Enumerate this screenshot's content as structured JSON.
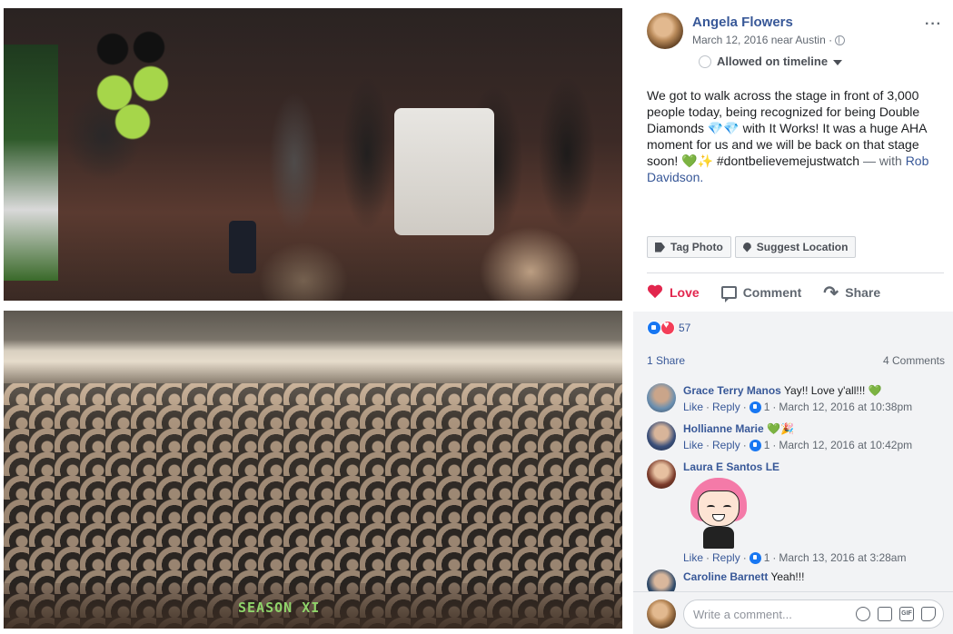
{
  "post": {
    "author": "Angela Flowers",
    "meta": "March 12, 2016 near Austin ·",
    "more": "···",
    "audience": "Allowed on timeline",
    "text_main": "We got to walk across the stage in front of 3,000 people today, being recognized for being Double Diamonds 💎💎 with It Works! It was a huge AHA moment for us and we will be back on that stage soon! 💚✨ #dontbelievemejustwatch",
    "text_with": " — with ",
    "tagged": "Rob Davidson.",
    "photo_caption": "SEASON XI"
  },
  "tag_bar": {
    "tag_photo": "Tag Photo",
    "suggest_location": "Suggest Location"
  },
  "actions": {
    "love": "Love",
    "comment": "Comment",
    "share": "Share"
  },
  "stats": {
    "reactions_count": "57",
    "shares": "1 Share",
    "comments": "4 Comments"
  },
  "comments": [
    {
      "name": "Grace Terry Manos",
      "text": " Yay!! Love y'all!!! 💚",
      "like": "Like",
      "reply": "Reply",
      "likes": "1",
      "time": "March 12, 2016 at 10:38pm"
    },
    {
      "name": "Hollianne Marie",
      "text": " 💚🎉",
      "like": "Like",
      "reply": "Reply",
      "likes": "1",
      "time": "March 12, 2016 at 10:42pm"
    },
    {
      "name": "Laura E Santos LE",
      "text": "",
      "like": "Like",
      "reply": "Reply",
      "likes": "1",
      "time": "March 13, 2016 at 3:28am"
    },
    {
      "name": "Caroline Barnett",
      "text": " Yeah!!!"
    }
  ],
  "composer": {
    "placeholder": "Write a comment...",
    "gif_label": "GIF"
  },
  "colors": {
    "link": "#385898",
    "love": "#e2264d",
    "panel": "#f2f3f5"
  }
}
